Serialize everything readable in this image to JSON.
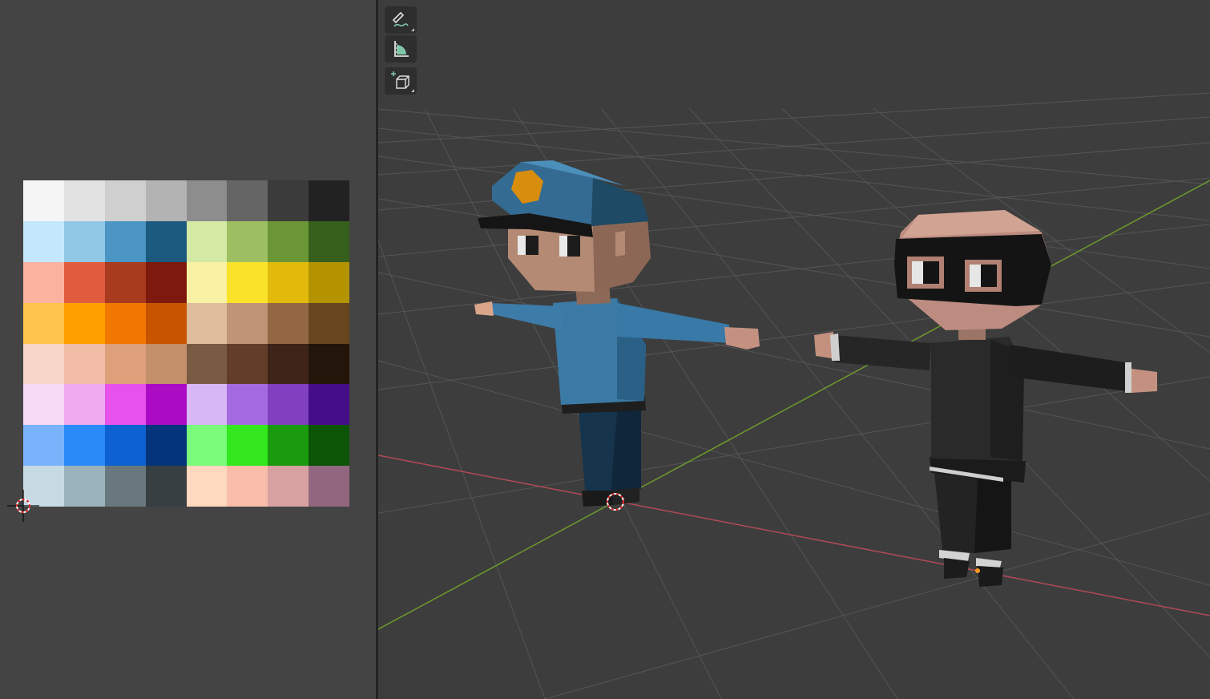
{
  "image_editor": {
    "palette": [
      "#f5f5f5",
      "#e2e2e2",
      "#cfcfcf",
      "#b3b3b3",
      "#8d8d8d",
      "#656565",
      "#3b3b3b",
      "#222222",
      "#c3e8fc",
      "#91c8e5",
      "#4a95c4",
      "#1b5a7e",
      "#d4eaa4",
      "#9dbf62",
      "#6a9636",
      "#355f1a",
      "#fbb29f",
      "#e05c3d",
      "#a83a1e",
      "#7e1a0d",
      "#f9f2a4",
      "#f9e229",
      "#e2ba0c",
      "#b39300",
      "#ffc44d",
      "#ffa000",
      "#f07800",
      "#c75500",
      "#ddbd9b",
      "#c09575",
      "#936741",
      "#68451d",
      "#f7d6c9",
      "#f0bca5",
      "#dea07a",
      "#c3906b",
      "#7a5a43",
      "#633d2a",
      "#3e2418",
      "#231509",
      "#f6daf6",
      "#eeacef",
      "#e652eb",
      "#ab0bc4",
      "#d8b7f7",
      "#a56ae0",
      "#8040c0",
      "#460d89",
      "#79b3fb",
      "#2a8af8",
      "#0d61d1",
      "#03347c",
      "#7afc7a",
      "#33e81f",
      "#1a9a0f",
      "#0c5406",
      "#c5dae3",
      "#9ab3bd",
      "#69787e",
      "#373f43",
      "#fed8bf",
      "#f8bda8",
      "#d7a1a1",
      "#91677f"
    ]
  },
  "viewport": {
    "toolbar": [
      {
        "id": "annotate",
        "icon": "annotate-icon"
      },
      {
        "id": "measure",
        "icon": "measure-icon"
      },
      {
        "id": "add-cube",
        "icon": "add-cube-icon"
      }
    ],
    "colors": {
      "background": "#3d3d3d",
      "grid": "#555555",
      "x_axis": "#b04a55",
      "y_axis": "#6e9a2c",
      "accent_tool_icon": "#7fc6a8"
    }
  }
}
